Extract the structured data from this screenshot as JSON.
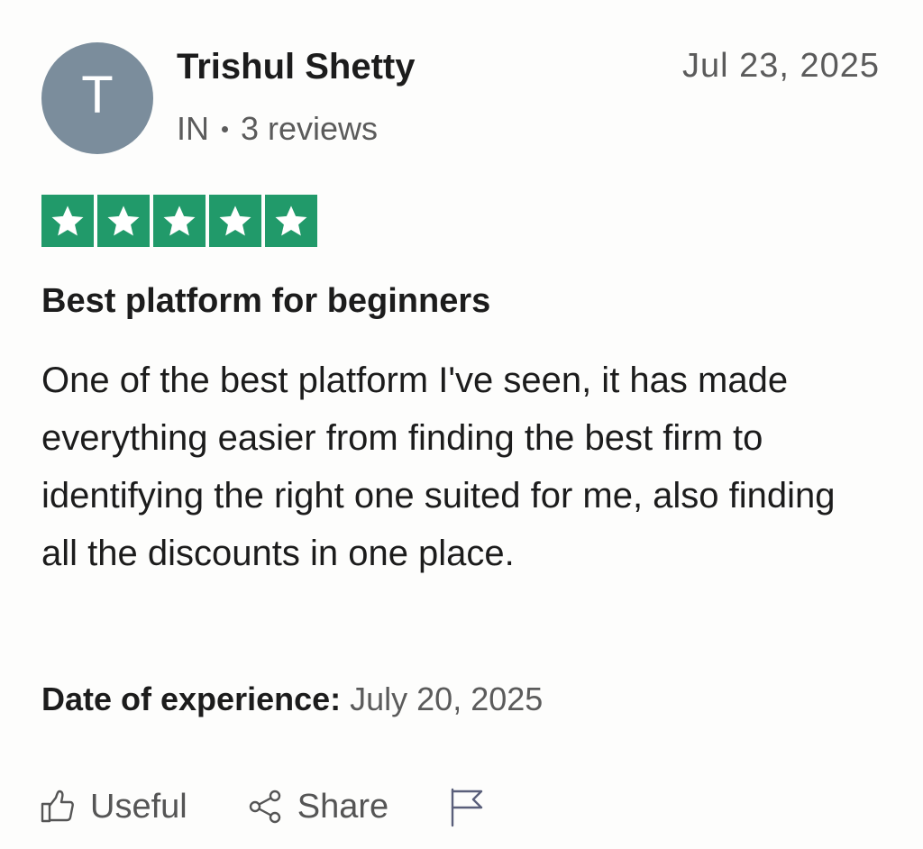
{
  "reviewer": {
    "initial": "T",
    "name": "Trishul Shetty",
    "country": "IN",
    "review_count": "3 reviews",
    "avatar_color": "#7b8d9c"
  },
  "review": {
    "date": "Jul 23, 2025",
    "rating": 5,
    "rating_max": 5,
    "star_color": "#219a6a",
    "title": "Best platform for beginners",
    "text": "One of the best platform I've seen, it has made everything easier from finding the best firm to identifying the right one suited for me, also finding all the discounts in one place.",
    "experience_label": "Date of experience:",
    "experience_date": "July 20, 2025"
  },
  "actions": {
    "useful_label": "Useful",
    "useful_icon": "thumbs-up-icon",
    "share_label": "Share",
    "share_icon": "share-icon",
    "flag_icon": "flag-icon"
  }
}
